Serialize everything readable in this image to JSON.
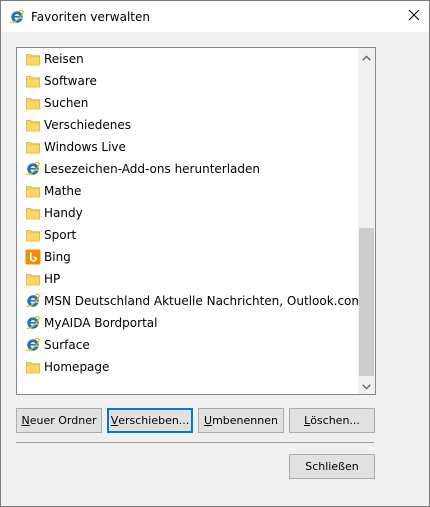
{
  "window": {
    "title": "Favoriten verwalten"
  },
  "favorites": {
    "items": [
      {
        "label": "Reisen",
        "icon": "folder-icon"
      },
      {
        "label": "Software",
        "icon": "folder-icon"
      },
      {
        "label": "Suchen",
        "icon": "folder-icon"
      },
      {
        "label": "Verschiedenes",
        "icon": "folder-icon"
      },
      {
        "label": "Windows Live",
        "icon": "folder-icon"
      },
      {
        "label": "Lesezeichen-Add-ons herunterladen",
        "icon": "ie-icon"
      },
      {
        "label": "Mathe",
        "icon": "folder-icon"
      },
      {
        "label": "Handy",
        "icon": "folder-icon"
      },
      {
        "label": "Sport",
        "icon": "folder-icon"
      },
      {
        "label": "Bing",
        "icon": "bing-icon"
      },
      {
        "label": "HP",
        "icon": "folder-icon"
      },
      {
        "label": "MSN Deutschland Aktuelle Nachrichten, Outlook.com E...",
        "icon": "ie-icon"
      },
      {
        "label": "MyAIDA Bordportal",
        "icon": "ie-icon"
      },
      {
        "label": "Surface",
        "icon": "ie-icon"
      },
      {
        "label": "Homepage",
        "icon": "folder-icon"
      }
    ]
  },
  "buttons": {
    "new_folder": {
      "pre": "",
      "key": "N",
      "post": "euer Ordner"
    },
    "move": {
      "pre": "",
      "key": "V",
      "post": "erschieben..."
    },
    "rename": {
      "pre": "",
      "key": "U",
      "post": "mbenennen"
    },
    "delete": {
      "pre": "",
      "key": "L",
      "post": "öschen..."
    },
    "close": "Schließen"
  },
  "colors": {
    "folder": "#ffd766",
    "ie": "#1b76c4",
    "bing": "#f28c00",
    "accent": "#0078d7"
  }
}
